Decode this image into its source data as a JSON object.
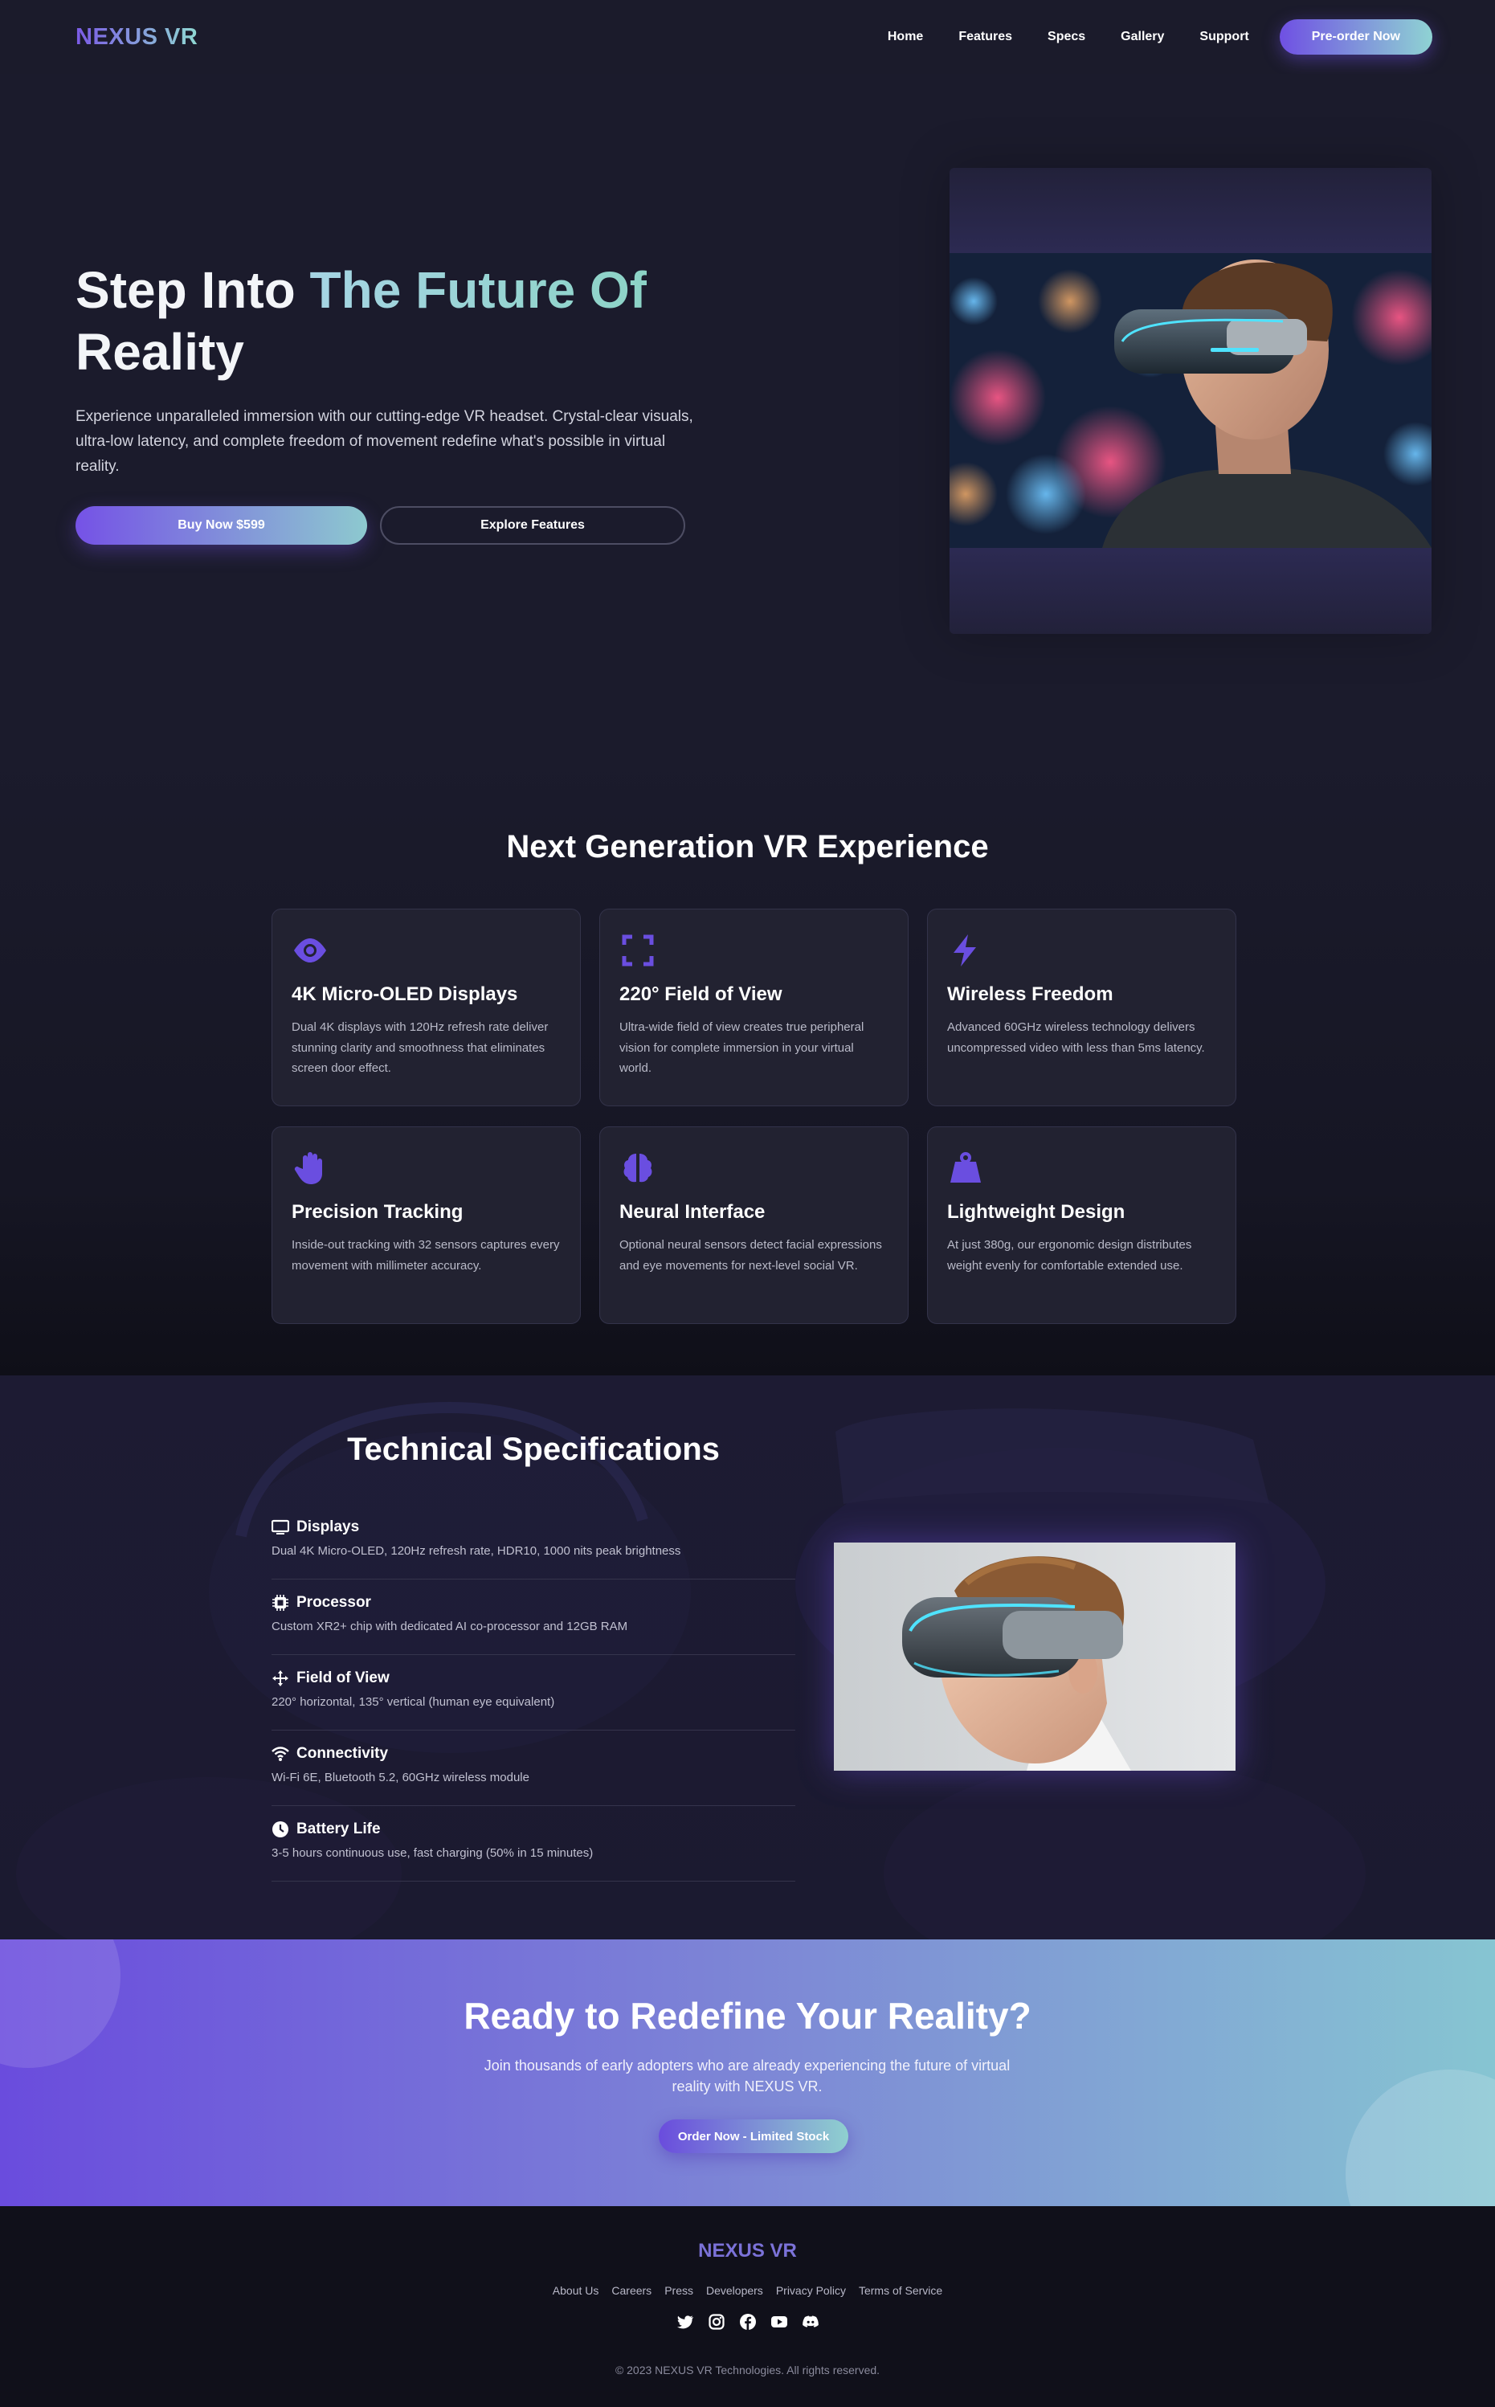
{
  "brand": {
    "logo": "NEXUS VR",
    "colors": {
      "accent_purple": "#6f50e3",
      "accent_teal": "#8fd3d3",
      "background": "#1b1b2b",
      "card_bg": "#222231"
    }
  },
  "nav": {
    "links": [
      "Home",
      "Features",
      "Specs",
      "Gallery",
      "Support"
    ],
    "cta": "Pre-order Now"
  },
  "hero": {
    "title_part1": "Step Into ",
    "title_accent": "The Future Of",
    "title_part2": "Reality",
    "description": "Experience unparalleled immersion with our cutting-edge VR headset. Crystal-clear visuals, ultra-low latency, and complete freedom of movement redefine what's possible in virtual reality.",
    "primary_button": "Buy Now $599",
    "secondary_button": "Explore Features"
  },
  "features": {
    "title": "Next Generation VR Experience",
    "items": [
      {
        "icon": "eye-icon",
        "title": "4K Micro-OLED Displays",
        "text": "Dual 4K displays with 120Hz refresh rate deliver stunning clarity and smoothness that eliminates screen door effect."
      },
      {
        "icon": "expand-icon",
        "title": "220° Field of View",
        "text": "Ultra-wide field of view creates true peripheral vision for complete immersion in your virtual world."
      },
      {
        "icon": "bolt-icon",
        "title": "Wireless Freedom",
        "text": "Advanced 60GHz wireless technology delivers uncompressed video with less than 5ms latency."
      },
      {
        "icon": "hand-icon",
        "title": "Precision Tracking",
        "text": "Inside-out tracking with 32 sensors captures every movement with millimeter accuracy."
      },
      {
        "icon": "brain-icon",
        "title": "Neural Interface",
        "text": "Optional neural sensors detect facial expressions and eye movements for next-level social VR."
      },
      {
        "icon": "weight-icon",
        "title": "Lightweight Design",
        "text": "At just 380g, our ergonomic design distributes weight evenly for comfortable extended use."
      }
    ]
  },
  "specs": {
    "title": "Technical Specifications",
    "items": [
      {
        "icon": "monitor-icon",
        "label": "Displays",
        "value": "Dual 4K Micro-OLED, 120Hz refresh rate, HDR10, 1000 nits peak brightness"
      },
      {
        "icon": "microchip-icon",
        "label": "Processor",
        "value": "Custom XR2+ chip with dedicated AI co-processor and 12GB RAM"
      },
      {
        "icon": "arrows-icon",
        "label": "Field of View",
        "value": "220° horizontal, 135° vertical (human eye equivalent)"
      },
      {
        "icon": "wifi-icon",
        "label": "Connectivity",
        "value": "Wi-Fi 6E, Bluetooth 5.2, 60GHz wireless module"
      },
      {
        "icon": "clock-icon",
        "label": "Battery Life",
        "value": "3-5 hours continuous use, fast charging (50% in 15 minutes)"
      }
    ]
  },
  "cta": {
    "title": "Ready to Redefine Your Reality?",
    "description": "Join thousands of early adopters who are already experiencing the future of virtual reality with NEXUS VR.",
    "button": "Order Now - Limited Stock"
  },
  "footer": {
    "logo": "NEXUS VR",
    "links": [
      "About Us",
      "Careers",
      "Press",
      "Developers",
      "Privacy Policy",
      "Terms of Service"
    ],
    "socials": [
      "twitter-icon",
      "instagram-icon",
      "facebook-icon",
      "youtube-icon",
      "discord-icon"
    ],
    "copyright": "© 2023 NEXUS VR Technologies. All rights reserved."
  }
}
